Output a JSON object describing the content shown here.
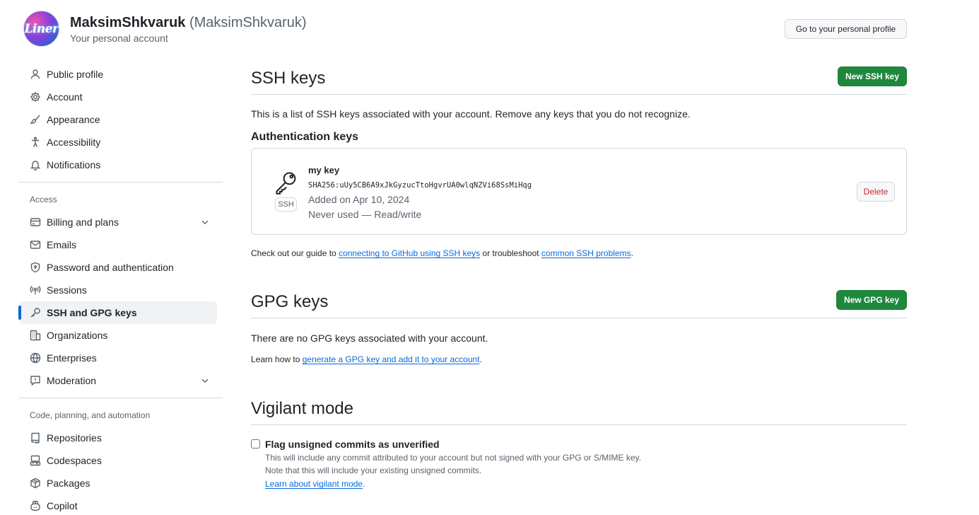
{
  "header": {
    "avatar_text": "Liner",
    "name": "MaksimShkvaruk",
    "login": "(MaksimShkvaruk)",
    "subtitle": "Your personal account",
    "profile_button": "Go to your personal profile"
  },
  "sidebar": {
    "group1": [
      {
        "label": "Public profile",
        "icon": "person-icon"
      },
      {
        "label": "Account",
        "icon": "gear-icon"
      },
      {
        "label": "Appearance",
        "icon": "paintbrush-icon"
      },
      {
        "label": "Accessibility",
        "icon": "accessibility-icon"
      },
      {
        "label": "Notifications",
        "icon": "bell-icon"
      }
    ],
    "access_heading": "Access",
    "access": [
      {
        "label": "Billing and plans",
        "icon": "credit-card-icon",
        "expandable": true
      },
      {
        "label": "Emails",
        "icon": "mail-icon"
      },
      {
        "label": "Password and authentication",
        "icon": "shield-lock-icon"
      },
      {
        "label": "Sessions",
        "icon": "broadcast-icon"
      },
      {
        "label": "SSH and GPG keys",
        "icon": "key-icon",
        "active": true
      },
      {
        "label": "Organizations",
        "icon": "organization-icon"
      },
      {
        "label": "Enterprises",
        "icon": "globe-icon"
      },
      {
        "label": "Moderation",
        "icon": "report-icon",
        "expandable": true
      }
    ],
    "code_heading": "Code, planning, and automation",
    "code": [
      {
        "label": "Repositories",
        "icon": "repo-icon"
      },
      {
        "label": "Codespaces",
        "icon": "codespaces-icon"
      },
      {
        "label": "Packages",
        "icon": "package-icon"
      },
      {
        "label": "Copilot",
        "icon": "copilot-icon"
      }
    ]
  },
  "ssh": {
    "title": "SSH keys",
    "new_button": "New SSH key",
    "description": "This is a list of SSH keys associated with your account. Remove any keys that you do not recognize.",
    "auth_heading": "Authentication keys",
    "key": {
      "name": "my key",
      "fingerprint": "SHA256:uUy5CB6A9xJkGyzucTtoHgvrUA0wlqNZVi68SsMiHqg",
      "added": "Added on Apr 10, 2024",
      "usage": "Never used — Read/write",
      "badge": "SSH",
      "delete_button": "Delete"
    },
    "guide_prefix": "Check out our guide to ",
    "guide_link1": "connecting to GitHub using SSH keys",
    "guide_middle": " or troubleshoot ",
    "guide_link2": "common SSH problems",
    "guide_suffix": "."
  },
  "gpg": {
    "title": "GPG keys",
    "new_button": "New GPG key",
    "empty_text": "There are no GPG keys associated with your account.",
    "learn_prefix": "Learn how to ",
    "learn_link": "generate a GPG key and add it to your account",
    "learn_suffix": "."
  },
  "vigilant": {
    "title": "Vigilant mode",
    "checkbox_label": "Flag unsigned commits as unverified",
    "checked": false,
    "note1": "This will include any commit attributed to your account but not signed with your GPG or S/MIME key.",
    "note2": "Note that this will include your existing unsigned commits.",
    "learn_link": "Learn about vigilant mode",
    "learn_suffix": "."
  },
  "colors": {
    "primary_green": "#1f883d",
    "link_blue": "#0969da",
    "danger_red": "#d1242f",
    "active_indicator": "#0969da"
  }
}
